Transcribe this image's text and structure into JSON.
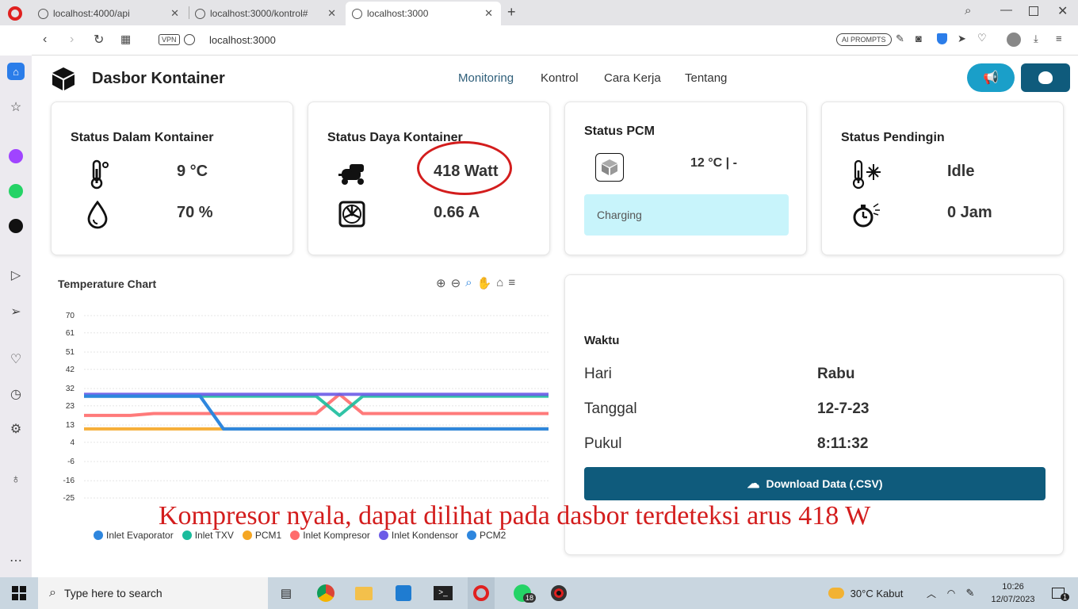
{
  "browser": {
    "tabs": [
      {
        "title": "localhost:4000/api"
      },
      {
        "title": "localhost:3000/kontrol#"
      },
      {
        "title": "localhost:3000"
      }
    ],
    "vpn_label": "VPN",
    "url": "localhost:3000",
    "ai_prompts": "AI PROMPTS"
  },
  "header": {
    "title": "Dasbor Kontainer",
    "nav": [
      "Monitoring",
      "Kontrol",
      "Cara Kerja",
      "Tentang"
    ]
  },
  "cards": {
    "dalam": {
      "title": "Status Dalam Kontainer",
      "temp": "9 °C",
      "humidity": "70 %"
    },
    "daya": {
      "title": "Status Daya Kontainer",
      "power": "418 Watt",
      "current": "0.66 A"
    },
    "pcm": {
      "title": "Status PCM",
      "temp": "12 °C | -",
      "status": "Charging"
    },
    "pendingin": {
      "title": "Status Pendingin",
      "state": "Idle",
      "hours": "0 Jam"
    }
  },
  "waktu": {
    "title": "Waktu",
    "hari_label": "Hari",
    "hari": "Rabu",
    "tanggal_label": "Tanggal",
    "tanggal": "12-7-23",
    "pukul_label": "Pukul",
    "pukul": "8:11:32",
    "download": "Download Data (.CSV)"
  },
  "caption": "Kompresor nyala, dapat dilihat pada dasbor terdeteksi arus 418 W",
  "chart_data": {
    "type": "line",
    "title": "Temperature Chart",
    "ylim": [
      -25,
      70
    ],
    "yticks": [
      70,
      61,
      51,
      42,
      32,
      23,
      13,
      4,
      -6,
      -16,
      -25
    ],
    "grid": true,
    "legend_placement": "bottom",
    "x": [
      0,
      1,
      2,
      3,
      4,
      5,
      6,
      7,
      8,
      9,
      10,
      11,
      12,
      13,
      14,
      15,
      16,
      17,
      18,
      19,
      20
    ],
    "series": [
      {
        "name": "Inlet Evaporator",
        "color": "#2e86de",
        "values": [
          28,
          28,
          28,
          28,
          28,
          28,
          11,
          11,
          11,
          11,
          11,
          11,
          11,
          11,
          11,
          11,
          11,
          11,
          11,
          11,
          11
        ]
      },
      {
        "name": "Inlet TXV",
        "color": "#1abc9c",
        "values": [
          28,
          28,
          28,
          28,
          28,
          28,
          28,
          28,
          28,
          28,
          28,
          18,
          28,
          28,
          28,
          28,
          28,
          28,
          28,
          28,
          28
        ]
      },
      {
        "name": "PCM1",
        "color": "#f5a623",
        "values": [
          11,
          11,
          11,
          11,
          11,
          11,
          11,
          11,
          11,
          11,
          11,
          11,
          11,
          11,
          11,
          11,
          11,
          11,
          11,
          11,
          11
        ]
      },
      {
        "name": "Inlet Kompresor",
        "color": "#ff6b6b",
        "values": [
          18,
          18,
          18,
          19,
          19,
          19,
          19,
          19,
          19,
          19,
          19,
          29,
          19,
          19,
          19,
          19,
          19,
          19,
          19,
          19,
          19
        ]
      },
      {
        "name": "Inlet Kondensor",
        "color": "#6c5ce7",
        "values": [
          29,
          29,
          29,
          29,
          29,
          29,
          29,
          29,
          29,
          29,
          29,
          29,
          29,
          29,
          29,
          29,
          29,
          29,
          29,
          29,
          29
        ]
      },
      {
        "name": "PCM2",
        "color": "#2e86de",
        "values": [
          28,
          28,
          28,
          28,
          28,
          28,
          11,
          11,
          11,
          11,
          11,
          11,
          11,
          11,
          11,
          11,
          11,
          11,
          11,
          11,
          11
        ]
      }
    ]
  },
  "taskbar": {
    "search": "Type here to search",
    "weather": "30°C  Kabut",
    "time": "10:26",
    "date": "12/07/2023",
    "badge": "18",
    "notif": "1"
  },
  "colors": {
    "accent": "#0f5b7c",
    "nav_active": "#2f5f7a",
    "pcm_bg": "#c8f4fb",
    "highlight": "#d31d1d"
  }
}
